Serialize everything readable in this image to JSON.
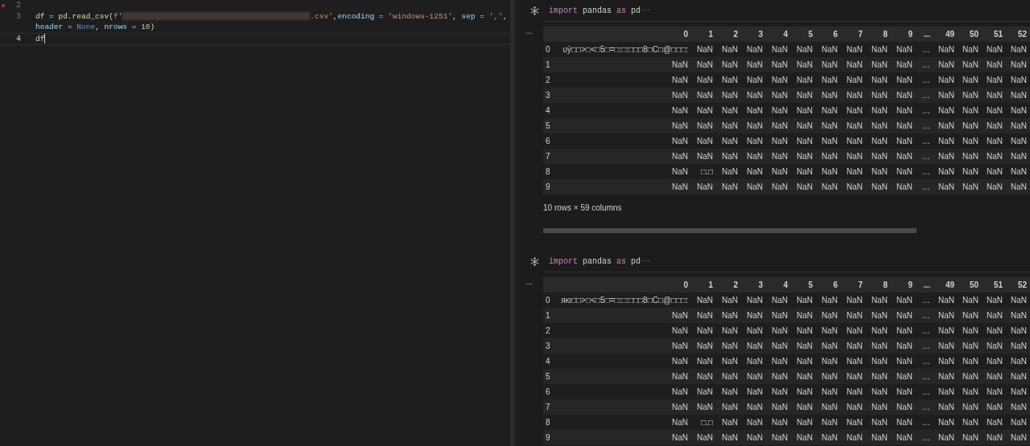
{
  "editor": {
    "lines": [
      {
        "number": "2",
        "error": true,
        "current": false
      },
      {
        "number": "3",
        "error": false,
        "current": false,
        "tokens": [
          {
            "kind": "plain",
            "text": "df = "
          },
          {
            "kind": "func",
            "text": "pd.read_csv("
          },
          {
            "kind": "string",
            "text": "f'"
          },
          {
            "kind": "redacted"
          },
          {
            "kind": "string",
            "text": ".csv'"
          },
          {
            "kind": "plain",
            "text": ","
          },
          {
            "kind": "param",
            "text": "encoding"
          },
          {
            "kind": "plain",
            "text": " = "
          },
          {
            "kind": "string",
            "text": "'windows-1251'"
          },
          {
            "kind": "plain",
            "text": ", "
          },
          {
            "kind": "param",
            "text": "sep"
          },
          {
            "kind": "plain",
            "text": " = "
          },
          {
            "kind": "string",
            "text": "','"
          },
          {
            "kind": "plain",
            "text": ","
          }
        ],
        "wrap": [
          {
            "kind": "param",
            "text": "header"
          },
          {
            "kind": "plain",
            "text": " = "
          },
          {
            "kind": "constant",
            "text": "None"
          },
          {
            "kind": "plain",
            "text": ", "
          },
          {
            "kind": "param",
            "text": "nrows"
          },
          {
            "kind": "plain",
            "text": " = "
          },
          {
            "kind": "number",
            "text": "10"
          },
          {
            "kind": "plain",
            "text": ")"
          }
        ]
      },
      {
        "number": "4",
        "error": false,
        "current": true,
        "tokens": [
          {
            "kind": "plain",
            "text": "df"
          }
        ]
      }
    ]
  },
  "outputs": [
    {
      "code": [
        {
          "kind": "keyword",
          "text": "import"
        },
        {
          "kind": "plain",
          "text": " pandas "
        },
        {
          "kind": "keyword",
          "text": "as"
        },
        {
          "kind": "plain",
          "text": " pd"
        }
      ],
      "collapsed": "⋯",
      "gutter": "...",
      "columns": [
        "0",
        "1",
        "2",
        "3",
        "4",
        "5",
        "6",
        "7",
        "8",
        "9",
        "...",
        "49",
        "50",
        "51",
        "52"
      ],
      "rows": [
        {
          "index": "0",
          "cells": [
            "υÿ□□>□<□5□=□:□:□□□8□C□@□□□:",
            "NaN",
            "NaN",
            "NaN",
            "NaN",
            "NaN",
            "NaN",
            "NaN",
            "NaN",
            "NaN",
            "…",
            "NaN",
            "NaN",
            "NaN",
            "NaN"
          ]
        },
        {
          "index": "1",
          "cells": [
            "NaN",
            "NaN",
            "NaN",
            "NaN",
            "NaN",
            "NaN",
            "NaN",
            "NaN",
            "NaN",
            "NaN",
            "…",
            "NaN",
            "NaN",
            "NaN",
            "NaN"
          ]
        },
        {
          "index": "2",
          "cells": [
            "NaN",
            "NaN",
            "NaN",
            "NaN",
            "NaN",
            "NaN",
            "NaN",
            "NaN",
            "NaN",
            "NaN",
            "…",
            "NaN",
            "NaN",
            "NaN",
            "NaN"
          ]
        },
        {
          "index": "3",
          "cells": [
            "NaN",
            "NaN",
            "NaN",
            "NaN",
            "NaN",
            "NaN",
            "NaN",
            "NaN",
            "NaN",
            "NaN",
            "…",
            "NaN",
            "NaN",
            "NaN",
            "NaN"
          ]
        },
        {
          "index": "4",
          "cells": [
            "NaN",
            "NaN",
            "NaN",
            "NaN",
            "NaN",
            "NaN",
            "NaN",
            "NaN",
            "NaN",
            "NaN",
            "…",
            "NaN",
            "NaN",
            "NaN",
            "NaN"
          ]
        },
        {
          "index": "5",
          "cells": [
            "NaN",
            "NaN",
            "NaN",
            "NaN",
            "NaN",
            "NaN",
            "NaN",
            "NaN",
            "NaN",
            "NaN",
            "…",
            "NaN",
            "NaN",
            "NaN",
            "NaN"
          ]
        },
        {
          "index": "6",
          "cells": [
            "NaN",
            "NaN",
            "NaN",
            "NaN",
            "NaN",
            "NaN",
            "NaN",
            "NaN",
            "NaN",
            "NaN",
            "…",
            "NaN",
            "NaN",
            "NaN",
            "NaN"
          ]
        },
        {
          "index": "7",
          "cells": [
            "NaN",
            "NaN",
            "NaN",
            "NaN",
            "NaN",
            "NaN",
            "NaN",
            "NaN",
            "NaN",
            "NaN",
            "…",
            "NaN",
            "NaN",
            "NaN",
            "NaN"
          ]
        },
        {
          "index": "8",
          "cells": [
            "NaN",
            "□.□",
            "NaN",
            "NaN",
            "NaN",
            "NaN",
            "NaN",
            "NaN",
            "NaN",
            "NaN",
            "…",
            "NaN",
            "NaN",
            "NaN",
            "NaN"
          ]
        },
        {
          "index": "9",
          "cells": [
            "NaN",
            "NaN",
            "NaN",
            "NaN",
            "NaN",
            "NaN",
            "NaN",
            "NaN",
            "NaN",
            "NaN",
            "…",
            "NaN",
            "NaN",
            "NaN",
            "NaN"
          ]
        }
      ],
      "footer": "10 rows × 59 columns",
      "scrollbar": true
    },
    {
      "code": [
        {
          "kind": "keyword",
          "text": "import"
        },
        {
          "kind": "plain",
          "text": " pandas "
        },
        {
          "kind": "keyword",
          "text": "as"
        },
        {
          "kind": "plain",
          "text": " pd"
        }
      ],
      "collapsed": "⋯",
      "gutter": "...",
      "columns": [
        "0",
        "1",
        "2",
        "3",
        "4",
        "5",
        "6",
        "7",
        "8",
        "9",
        "...",
        "49",
        "50",
        "51",
        "52"
      ],
      "rows": [
        {
          "index": "0",
          "cells": [
            "яю□□>□<□5□=□:□:□□□8□C□@□□□:",
            "NaN",
            "NaN",
            "NaN",
            "NaN",
            "NaN",
            "NaN",
            "NaN",
            "NaN",
            "NaN",
            "…",
            "NaN",
            "NaN",
            "NaN",
            "NaN"
          ]
        },
        {
          "index": "1",
          "cells": [
            "NaN",
            "NaN",
            "NaN",
            "NaN",
            "NaN",
            "NaN",
            "NaN",
            "NaN",
            "NaN",
            "NaN",
            "…",
            "NaN",
            "NaN",
            "NaN",
            "NaN"
          ]
        },
        {
          "index": "2",
          "cells": [
            "NaN",
            "NaN",
            "NaN",
            "NaN",
            "NaN",
            "NaN",
            "NaN",
            "NaN",
            "NaN",
            "NaN",
            "…",
            "NaN",
            "NaN",
            "NaN",
            "NaN"
          ]
        },
        {
          "index": "3",
          "cells": [
            "NaN",
            "NaN",
            "NaN",
            "NaN",
            "NaN",
            "NaN",
            "NaN",
            "NaN",
            "NaN",
            "NaN",
            "…",
            "NaN",
            "NaN",
            "NaN",
            "NaN"
          ]
        },
        {
          "index": "4",
          "cells": [
            "NaN",
            "NaN",
            "NaN",
            "NaN",
            "NaN",
            "NaN",
            "NaN",
            "NaN",
            "NaN",
            "NaN",
            "…",
            "NaN",
            "NaN",
            "NaN",
            "NaN"
          ]
        },
        {
          "index": "5",
          "cells": [
            "NaN",
            "NaN",
            "NaN",
            "NaN",
            "NaN",
            "NaN",
            "NaN",
            "NaN",
            "NaN",
            "NaN",
            "…",
            "NaN",
            "NaN",
            "NaN",
            "NaN"
          ]
        },
        {
          "index": "6",
          "cells": [
            "NaN",
            "NaN",
            "NaN",
            "NaN",
            "NaN",
            "NaN",
            "NaN",
            "NaN",
            "NaN",
            "NaN",
            "…",
            "NaN",
            "NaN",
            "NaN",
            "NaN"
          ]
        },
        {
          "index": "7",
          "cells": [
            "NaN",
            "NaN",
            "NaN",
            "NaN",
            "NaN",
            "NaN",
            "NaN",
            "NaN",
            "NaN",
            "NaN",
            "…",
            "NaN",
            "NaN",
            "NaN",
            "NaN"
          ]
        },
        {
          "index": "8",
          "cells": [
            "NaN",
            "□.□",
            "NaN",
            "NaN",
            "NaN",
            "NaN",
            "NaN",
            "NaN",
            "NaN",
            "NaN",
            "…",
            "NaN",
            "NaN",
            "NaN",
            "NaN"
          ]
        },
        {
          "index": "9",
          "cells": [
            "NaN",
            "NaN",
            "NaN",
            "NaN",
            "NaN",
            "NaN",
            "NaN",
            "NaN",
            "NaN",
            "NaN",
            "…",
            "NaN",
            "NaN",
            "NaN",
            "NaN"
          ]
        }
      ],
      "scrollbar": false
    }
  ]
}
